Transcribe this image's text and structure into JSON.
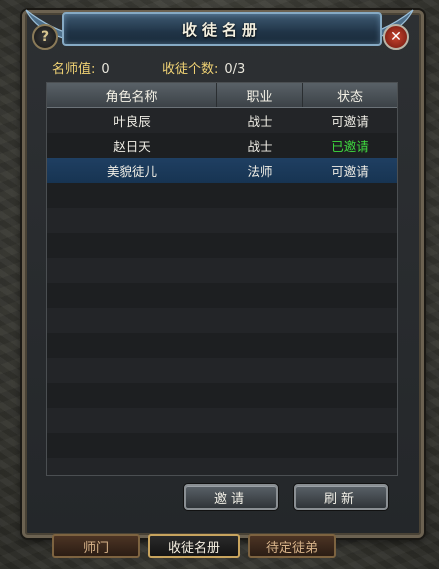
{
  "window": {
    "title": "收徒名册"
  },
  "stats": {
    "mentor_label": "名师值:",
    "mentor_value": "0",
    "count_label": "收徒个数:",
    "count_value": "0/3"
  },
  "table": {
    "headers": [
      "角色名称",
      "职业",
      "状态"
    ],
    "rows": [
      {
        "name": "叶良辰",
        "job": "战士",
        "status": "可邀请",
        "status_color": "#f0eee6"
      },
      {
        "name": "赵日天",
        "job": "战士",
        "status": "已邀请",
        "status_color": "#3fdc3f"
      },
      {
        "name": "美貌徒儿",
        "job": "法师",
        "status": "可邀请",
        "status_color": "#f0eee6"
      }
    ]
  },
  "buttons": {
    "invite": "邀请",
    "refresh": "刷新"
  },
  "tabs": [
    "师门",
    "收徒名册",
    "待定徒弟"
  ],
  "active_tab": "收徒名册",
  "icons": {
    "help": "?",
    "close": "✕"
  },
  "colors": {
    "label_gold": "#f0d274",
    "invited_green": "#3fdc3f",
    "selected_row": "#1f3f62"
  }
}
